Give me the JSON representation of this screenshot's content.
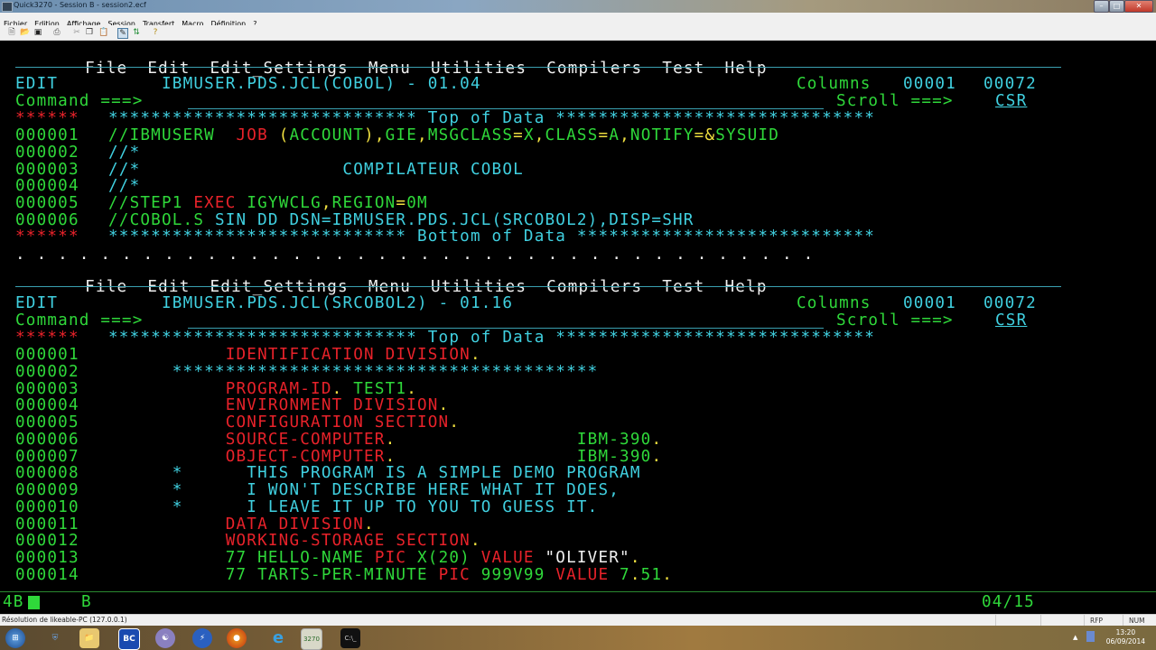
{
  "window": {
    "title": "Quick3270 - Session B - session2.ecf",
    "controls": [
      "minimize",
      "maximize",
      "close"
    ]
  },
  "app_menu": [
    "Fichier",
    "Edition",
    "Affichage",
    "Session",
    "Transfert",
    "Macro",
    "Définition",
    "?"
  ],
  "toolbar_icons": [
    "new-file-icon",
    "open-folder-icon",
    "save-icon",
    "print-icon",
    "cut-icon",
    "copy-icon",
    "paste-icon",
    "session-icon",
    "transfer-icon",
    "help-icon"
  ],
  "ispf_menu": [
    "File",
    "Edit",
    "Edit_Settings",
    "Menu",
    "Utilities",
    "Compilers",
    "Test",
    "Help"
  ],
  "panel1": {
    "mode": "EDIT",
    "dataset": "IBMUSER.PDS.JCL(COBOL) - 01.04",
    "columns_label": "Columns",
    "columns_from": "00001",
    "columns_to": "00072",
    "command_label": "Command ===>",
    "command_value": "",
    "scroll_label": "Scroll ===>",
    "scroll_value": "CSR",
    "top_marker": "******",
    "top_text": "***************************** Top of Data ******************************",
    "bottom_text": "**************************** Bottom of Data ****************************",
    "lines": [
      {
        "num": "000001",
        "segments": [
          [
            "g",
            "//IBMUSERW  "
          ],
          [
            "r",
            "JOB "
          ],
          [
            "y",
            "("
          ],
          [
            "g",
            "ACCOUNT"
          ],
          [
            "y",
            "),"
          ],
          [
            "g",
            "GIE"
          ],
          [
            "y",
            ","
          ],
          [
            "g",
            "MSGCLASS"
          ],
          [
            "y",
            "="
          ],
          [
            "g",
            "X"
          ],
          [
            "y",
            ","
          ],
          [
            "g",
            "CLASS"
          ],
          [
            "y",
            "="
          ],
          [
            "g",
            "A"
          ],
          [
            "y",
            ","
          ],
          [
            "g",
            "NOTIFY"
          ],
          [
            "y",
            "=&"
          ],
          [
            "g",
            "SYSUID"
          ]
        ]
      },
      {
        "num": "000002",
        "segments": [
          [
            "c",
            "//*"
          ]
        ]
      },
      {
        "num": "000003",
        "segments": [
          [
            "c",
            "//*                   COMPILATEUR COBOL"
          ]
        ]
      },
      {
        "num": "000004",
        "segments": [
          [
            "c",
            "//*"
          ]
        ]
      },
      {
        "num": "000005",
        "segments": [
          [
            "g",
            "//STEP1 "
          ],
          [
            "r",
            "EXEC "
          ],
          [
            "g",
            "IGYWCLG"
          ],
          [
            "y",
            ","
          ],
          [
            "g",
            "REGION"
          ],
          [
            "y",
            "="
          ],
          [
            "g",
            "0M"
          ]
        ]
      },
      {
        "num": "000006",
        "segments": [
          [
            "g",
            "//COBOL.S "
          ],
          [
            "c",
            "SIN DD DSN=IBMUSER.PDS.JCL(SRCOBOL2),DISP=SHR"
          ]
        ]
      }
    ]
  },
  "separator_dots": ". . . . . . . . . . . . . . . . . . . . . . . . . . . . . . . . . . . . . .",
  "panel2": {
    "mode": "EDIT",
    "dataset": "IBMUSER.PDS.JCL(SRCOBOL2) - 01.16",
    "columns_label": "Columns",
    "columns_from": "00001",
    "columns_to": "00072",
    "command_label": "Command ===>",
    "command_value": "",
    "scroll_label": "Scroll ===>",
    "scroll_value": "CSR",
    "top_marker": "******",
    "top_text": "***************************** Top of Data ******************************",
    "lines": [
      {
        "num": "000001",
        "segments": [
          [
            "r",
            "           IDENTIFICATION DIVISION"
          ],
          [
            "y",
            "."
          ]
        ]
      },
      {
        "num": "000002",
        "segments": [
          [
            "c",
            "      ****************************************"
          ]
        ]
      },
      {
        "num": "000003",
        "segments": [
          [
            "r",
            "           PROGRAM-ID"
          ],
          [
            "y",
            "."
          ],
          [
            "g",
            " TEST1"
          ],
          [
            "y",
            "."
          ]
        ]
      },
      {
        "num": "000004",
        "segments": [
          [
            "r",
            "           ENVIRONMENT DIVISION"
          ],
          [
            "y",
            "."
          ]
        ]
      },
      {
        "num": "000005",
        "segments": [
          [
            "r",
            "           CONFIGURATION SECTION"
          ],
          [
            "y",
            "."
          ]
        ]
      },
      {
        "num": "000006",
        "segments": [
          [
            "r",
            "           SOURCE-COMPUTER"
          ],
          [
            "y",
            "."
          ],
          [
            "g",
            "                 IBM-390"
          ],
          [
            "y",
            "."
          ]
        ]
      },
      {
        "num": "000007",
        "segments": [
          [
            "r",
            "           OBJECT-COMPUTER"
          ],
          [
            "y",
            "."
          ],
          [
            "g",
            "                 IBM-390"
          ],
          [
            "y",
            "."
          ]
        ]
      },
      {
        "num": "000008",
        "segments": [
          [
            "c",
            "      *      THIS PROGRAM IS A SIMPLE DEMO PROGRAM"
          ]
        ]
      },
      {
        "num": "000009",
        "segments": [
          [
            "c",
            "      *      I WON'T DESCRIBE HERE WHAT IT DOES,"
          ]
        ]
      },
      {
        "num": "000010",
        "segments": [
          [
            "c",
            "      *      I LEAVE IT UP TO YOU TO GUESS IT."
          ]
        ]
      },
      {
        "num": "000011",
        "segments": [
          [
            "r",
            "           DATA DIVISION"
          ],
          [
            "y",
            "."
          ]
        ]
      },
      {
        "num": "000012",
        "segments": [
          [
            "r",
            "           WORKING-STORAGE SECTION"
          ],
          [
            "y",
            "."
          ]
        ]
      },
      {
        "num": "000013",
        "segments": [
          [
            "g",
            "           77 HELLO-NAME "
          ],
          [
            "r",
            "PIC "
          ],
          [
            "g",
            "X(20) "
          ],
          [
            "r",
            "VALUE "
          ],
          [
            "w",
            "\"OLIVER\""
          ],
          [
            "y",
            "."
          ]
        ]
      },
      {
        "num": "000014",
        "segments": [
          [
            "g",
            "           77 TARTS-PER-MINUTE "
          ],
          [
            "r",
            "PIC "
          ],
          [
            "g",
            "999V99 "
          ],
          [
            "r",
            "VALUE "
          ],
          [
            "g",
            "7"
          ],
          [
            "y",
            "."
          ],
          [
            "g",
            "51"
          ],
          [
            "y",
            "."
          ]
        ]
      }
    ]
  },
  "oia": {
    "left": "4B",
    "session": "B",
    "cursor_pos": "04/15"
  },
  "statusbar": {
    "text": "Résolution de likeable-PC (127.0.0.1)",
    "rfp": "RFP",
    "num": "NUM"
  },
  "taskbar": {
    "apps": [
      "start-button",
      "security-app",
      "file-explorer",
      "beyond-compare",
      "app-c",
      "daemon-tools",
      "firefox",
      "internet-explorer",
      "quick3270",
      "cmd"
    ],
    "bc_label": "BC",
    "time": "13:20",
    "date": "06/09/2014"
  }
}
